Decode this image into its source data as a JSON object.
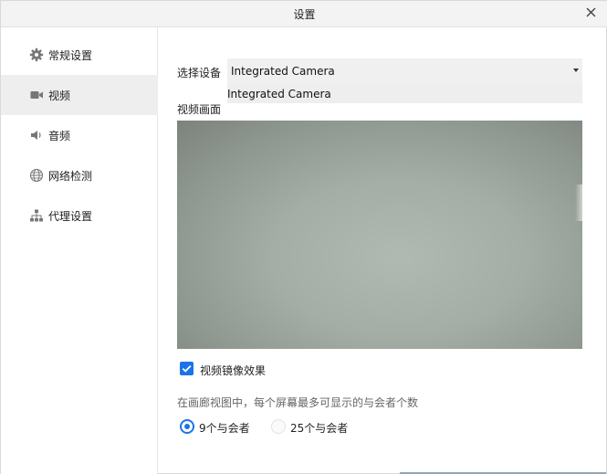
{
  "window": {
    "title": "设置"
  },
  "sidebar": {
    "items": [
      {
        "label": "常规设置",
        "icon": "gear-icon",
        "active": false
      },
      {
        "label": "视频",
        "icon": "video-camera-icon",
        "active": true
      },
      {
        "label": "音频",
        "icon": "speaker-icon",
        "active": false
      },
      {
        "label": "网络检测",
        "icon": "globe-icon",
        "active": false
      },
      {
        "label": "代理设置",
        "icon": "network-tree-icon",
        "active": false
      }
    ]
  },
  "video": {
    "device_label": "选择设备",
    "device_selected": "Integrated Camera",
    "device_options": [
      "Integrated Camera"
    ],
    "preview_label": "视频画面",
    "mirror_label": "视频镜像效果",
    "mirror_checked": true,
    "max_participants_label": "在画廊视图中，每个屏幕最多可显示的与会者个数",
    "options": [
      {
        "label": "9个与会者",
        "checked": true
      },
      {
        "label": "25个与会者",
        "checked": false
      }
    ]
  },
  "colors": {
    "accent": "#1a73e8",
    "sidebar_active": "#eeeeee",
    "titlebar": "#f3f3f3"
  }
}
